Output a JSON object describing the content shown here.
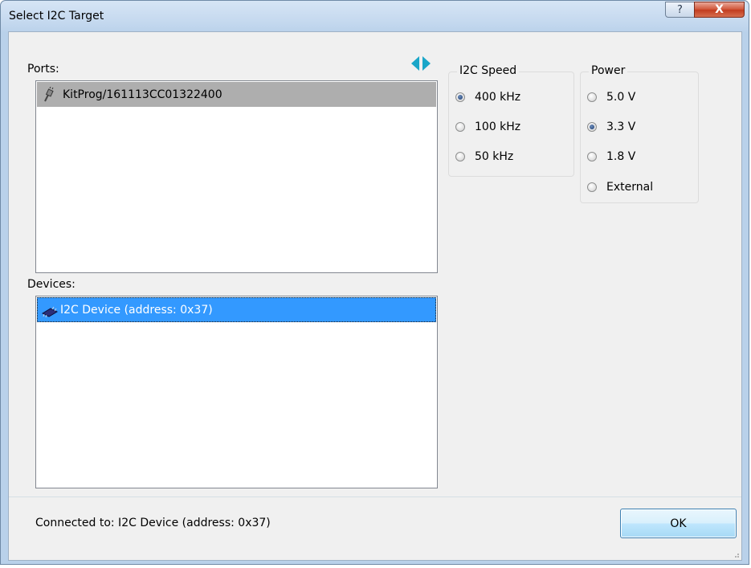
{
  "window": {
    "title": "Select I2C Target",
    "help_glyph": "?",
    "close_glyph": "X"
  },
  "ports": {
    "label": "Ports:",
    "items": [
      {
        "name": "KitProg/161113CC01322400",
        "icon": "plug-icon"
      }
    ],
    "selected_index": 0
  },
  "devices": {
    "label": "Devices:",
    "items": [
      {
        "name": "I2C Device (address: 0x37)",
        "icon": "chip-icon"
      }
    ],
    "selected_index": 0
  },
  "sync_icon": "refresh-arrows-icon",
  "i2c_speed": {
    "legend": "I2C Speed",
    "options": [
      {
        "label": "400 kHz",
        "checked": true
      },
      {
        "label": "100 kHz",
        "checked": false
      },
      {
        "label": "50 kHz",
        "checked": false
      }
    ]
  },
  "power": {
    "legend": "Power",
    "options": [
      {
        "label": "5.0 V",
        "checked": false
      },
      {
        "label": "3.3 V",
        "checked": true
      },
      {
        "label": "1.8 V",
        "checked": false
      },
      {
        "label": "External",
        "checked": false
      }
    ]
  },
  "status": {
    "text": "Connected to: I2C Device (address: 0x37)"
  },
  "ok_button": {
    "label": "OK"
  },
  "colors": {
    "selection_blue": "#3399ff",
    "inactive_selection_gray": "#aeaeae",
    "sync_icon_teal": "#1aa6c8"
  }
}
